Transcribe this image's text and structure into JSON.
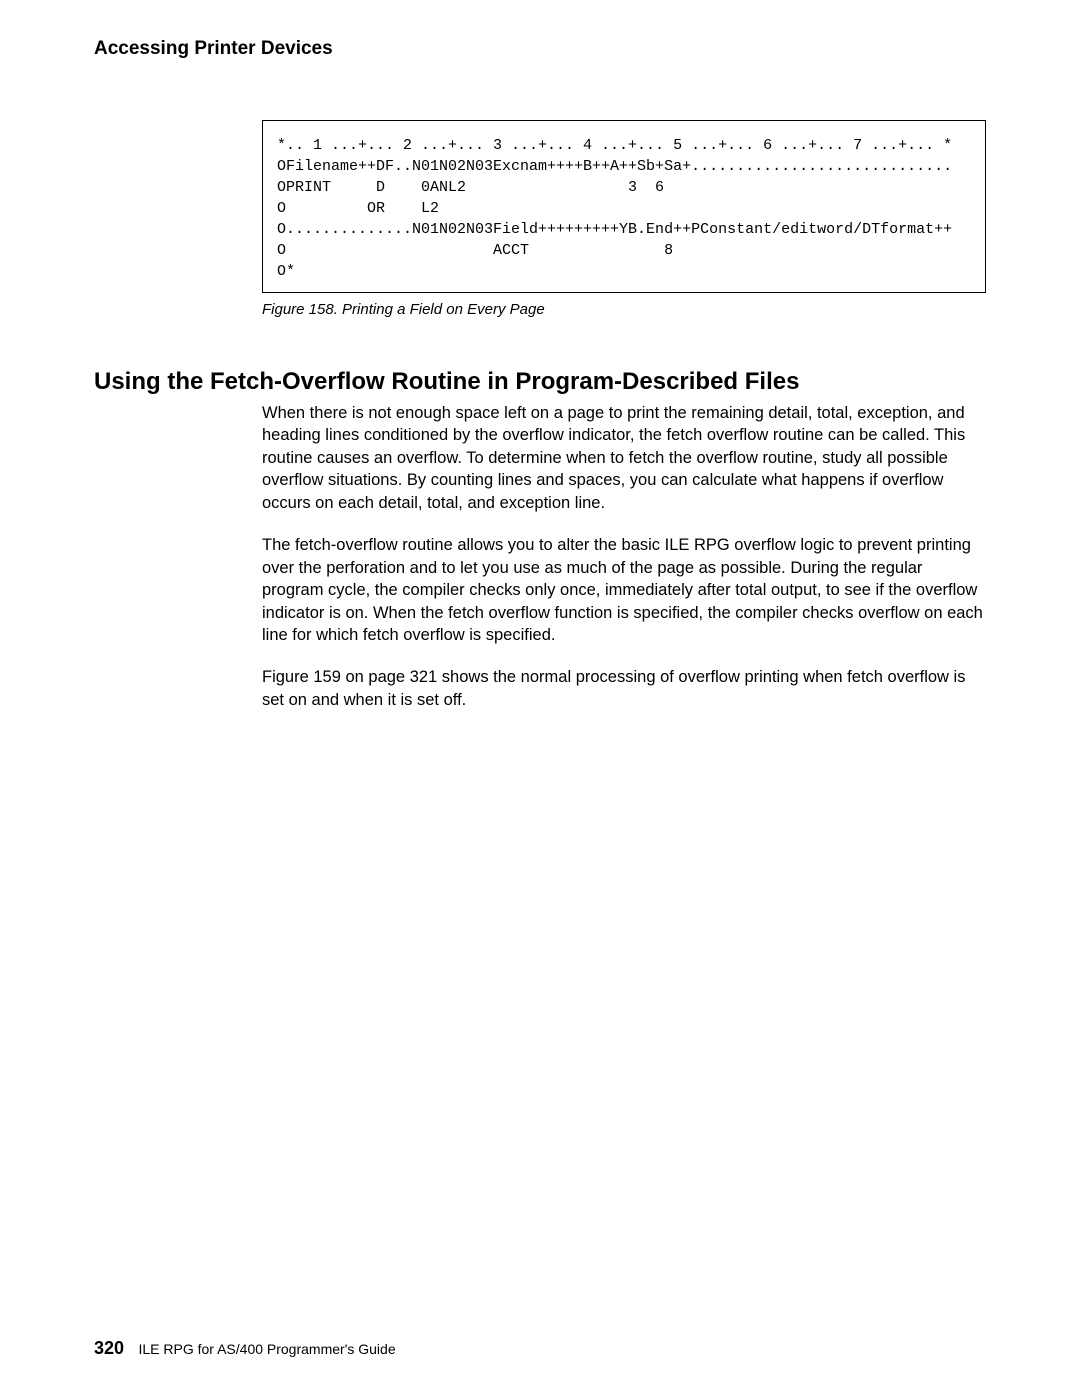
{
  "header": {
    "title": "Accessing Printer Devices"
  },
  "figure": {
    "code_lines": [
      "*.. 1 ...+... 2 ...+... 3 ...+... 4 ...+... 5 ...+... 6 ...+... 7 ...+... *",
      "OFilename++DF..N01N02N03Excnam++++B++A++Sb+Sa+.............................",
      "OPRINT     D    0ANL2                  3  6",
      "O         OR    L2",
      "O..............N01N02N03Field+++++++++YB.End++PConstant/editword/DTformat++",
      "O                       ACCT               8",
      "O*"
    ],
    "caption": "Figure  158.  Printing a Field on Every Page"
  },
  "section": {
    "heading": "Using the Fetch-Overflow Routine in Program-Described Files",
    "paragraphs": [
      "When there is not enough space left on a page to print the remaining detail, total, exception, and heading lines conditioned by the overflow indicator, the fetch overflow routine can be called. This routine causes an overflow. To determine when to fetch the overflow routine, study all possible overflow situations. By counting lines and spaces, you can calculate what happens if overflow occurs on each detail, total, and exception line.",
      "The fetch-overflow routine allows you to alter the basic ILE RPG overflow logic to prevent printing over the perforation and to let you use as much of the page as possible. During the regular program cycle, the compiler checks only once, immediately after total output, to see if the overflow indicator is on. When the fetch overflow function is specified, the compiler checks overflow on each line for which fetch overflow is specified.",
      "Figure  159 on page  321 shows the normal processing of overflow printing when fetch overflow is set on and when it is set off."
    ]
  },
  "footer": {
    "page_number": "320",
    "text": "ILE RPG for AS/400 Programmer's Guide"
  }
}
